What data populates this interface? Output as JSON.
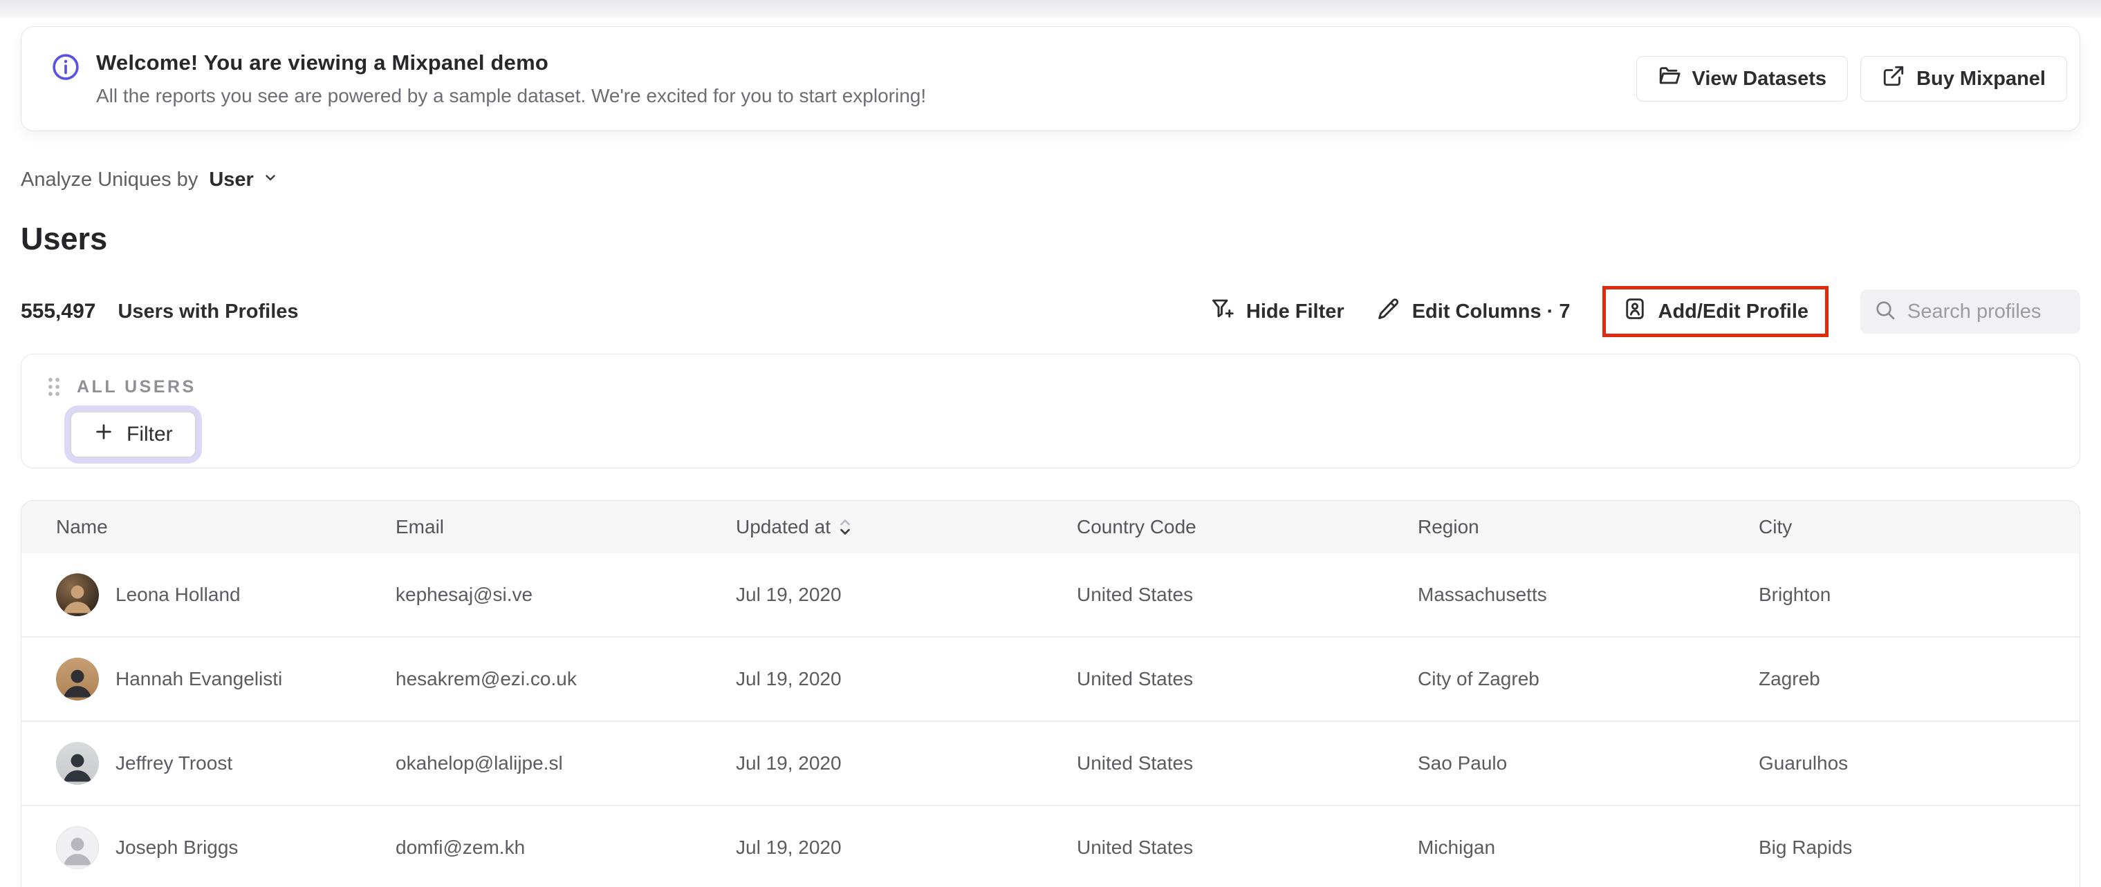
{
  "banner": {
    "title": "Welcome! You are viewing a Mixpanel demo",
    "subtitle": "All the reports you see are powered by a sample dataset. We're excited for you to start exploring!",
    "buttons": [
      {
        "label": "View Datasets",
        "icon": "folder-icon"
      },
      {
        "label": "Buy Mixpanel",
        "icon": "external-link-icon"
      }
    ]
  },
  "controls": {
    "analyze_label": "Analyze Uniques by",
    "analyze_value": "User",
    "page_title": "Users",
    "count": "555,497",
    "count_label": "Users with Profiles",
    "hide_filter": "Hide Filter",
    "edit_columns": "Edit Columns · 7",
    "add_edit_profile": "Add/Edit Profile",
    "search_placeholder": "Search profiles"
  },
  "filter_panel": {
    "group_label": "ALL USERS",
    "filter_button": "Filter"
  },
  "table": {
    "columns": [
      "Name",
      "Email",
      "Updated at",
      "Country Code",
      "Region",
      "City"
    ],
    "rows": [
      {
        "name": "Leona Holland",
        "email": "kephesaj@si.ve",
        "updated_at": "Jul 19, 2020",
        "country_code": "United States",
        "region": "Massachusetts",
        "city": "Brighton"
      },
      {
        "name": "Hannah Evangelisti",
        "email": "hesakrem@ezi.co.uk",
        "updated_at": "Jul 19, 2020",
        "country_code": "United States",
        "region": "City of Zagreb",
        "city": "Zagreb"
      },
      {
        "name": "Jeffrey Troost",
        "email": "okahelop@lalijpe.sl",
        "updated_at": "Jul 19, 2020",
        "country_code": "United States",
        "region": "Sao Paulo",
        "city": "Guarulhos"
      },
      {
        "name": "Joseph Briggs",
        "email": "domfi@zem.kh",
        "updated_at": "Jul 19, 2020",
        "country_code": "United States",
        "region": "Michigan",
        "city": "Big Rapids"
      }
    ]
  },
  "colors": {
    "accent_purple": "#5a50e8",
    "highlight_red": "#df2a0d",
    "focus_ring_lavender": "#dcd9f8"
  }
}
